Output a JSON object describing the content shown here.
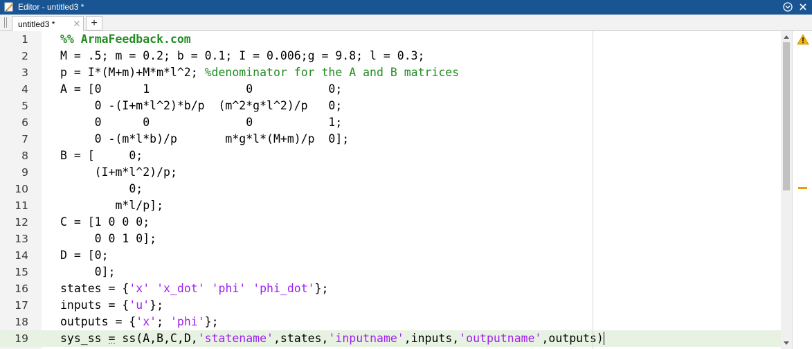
{
  "titlebar": {
    "title": "Editor - untitled3 *",
    "app_icon": "editor-icon",
    "buttons": [
      "options-icon",
      "close-icon"
    ]
  },
  "tabs": {
    "items": [
      {
        "label": "untitled3 *",
        "close_icon": "close-icon"
      }
    ],
    "new_tab_label": "+"
  },
  "editor": {
    "current_line": 19,
    "warning_icon": "warning-icon",
    "lines": [
      {
        "n": "1",
        "segs": [
          {
            "t": "%% ArmaFeedback.com",
            "c": "cmt hdr"
          }
        ]
      },
      {
        "n": "2",
        "segs": [
          {
            "t": "M = .5; m = 0.2; b = 0.1; I = 0.006;g = 9.8; l = 0.3;",
            "c": ""
          }
        ]
      },
      {
        "n": "3",
        "segs": [
          {
            "t": "p = I*(M+m)+M*m*l^2; ",
            "c": ""
          },
          {
            "t": "%denominator for the A and B matrices",
            "c": "cmt"
          }
        ]
      },
      {
        "n": "4",
        "segs": [
          {
            "t": "A = [0      1              0           0;",
            "c": ""
          }
        ]
      },
      {
        "n": "5",
        "segs": [
          {
            "t": "     0 -(I+m*l^2)*b/p  (m^2*g*l^2)/p   0;",
            "c": ""
          }
        ]
      },
      {
        "n": "6",
        "segs": [
          {
            "t": "     0      0              0           1;",
            "c": ""
          }
        ]
      },
      {
        "n": "7",
        "segs": [
          {
            "t": "     0 -(m*l*b)/p       m*g*l*(M+m)/p  0];",
            "c": ""
          }
        ]
      },
      {
        "n": "8",
        "segs": [
          {
            "t": "B = [     0;",
            "c": ""
          }
        ]
      },
      {
        "n": "9",
        "segs": [
          {
            "t": "     (I+m*l^2)/p;",
            "c": ""
          }
        ]
      },
      {
        "n": "10",
        "segs": [
          {
            "t": "          0;",
            "c": ""
          }
        ]
      },
      {
        "n": "11",
        "segs": [
          {
            "t": "        m*l/p];",
            "c": ""
          }
        ]
      },
      {
        "n": "12",
        "segs": [
          {
            "t": "C = [1 0 0 0;",
            "c": ""
          }
        ]
      },
      {
        "n": "13",
        "segs": [
          {
            "t": "     0 0 1 0];",
            "c": ""
          }
        ]
      },
      {
        "n": "14",
        "segs": [
          {
            "t": "D = [0;",
            "c": ""
          }
        ]
      },
      {
        "n": "15",
        "segs": [
          {
            "t": "     0];",
            "c": ""
          }
        ]
      },
      {
        "n": "16",
        "segs": [
          {
            "t": "states = {",
            "c": ""
          },
          {
            "t": "'x'",
            "c": "str"
          },
          {
            "t": " ",
            "c": ""
          },
          {
            "t": "'x_dot'",
            "c": "str"
          },
          {
            "t": " ",
            "c": ""
          },
          {
            "t": "'phi'",
            "c": "str"
          },
          {
            "t": " ",
            "c": ""
          },
          {
            "t": "'phi_dot'",
            "c": "str"
          },
          {
            "t": "};",
            "c": ""
          }
        ]
      },
      {
        "n": "17",
        "segs": [
          {
            "t": "inputs = {",
            "c": ""
          },
          {
            "t": "'u'",
            "c": "str"
          },
          {
            "t": "};",
            "c": ""
          }
        ]
      },
      {
        "n": "18",
        "segs": [
          {
            "t": "outputs = {",
            "c": ""
          },
          {
            "t": "'x'",
            "c": "str"
          },
          {
            "t": "; ",
            "c": ""
          },
          {
            "t": "'phi'",
            "c": "str"
          },
          {
            "t": "};",
            "c": ""
          }
        ]
      },
      {
        "n": "19",
        "segs": [
          {
            "t": "sys_ss ",
            "c": ""
          },
          {
            "t": "=",
            "c": "eqmark"
          },
          {
            "t": " ss(A,B,C,D,",
            "c": ""
          },
          {
            "t": "'statename'",
            "c": "str"
          },
          {
            "t": ",states,",
            "c": ""
          },
          {
            "t": "'inputname'",
            "c": "str"
          },
          {
            "t": ",inputs,",
            "c": ""
          },
          {
            "t": "'outputname'",
            "c": "str"
          },
          {
            "t": ",outputs)",
            "c": ""
          }
        ]
      }
    ]
  }
}
